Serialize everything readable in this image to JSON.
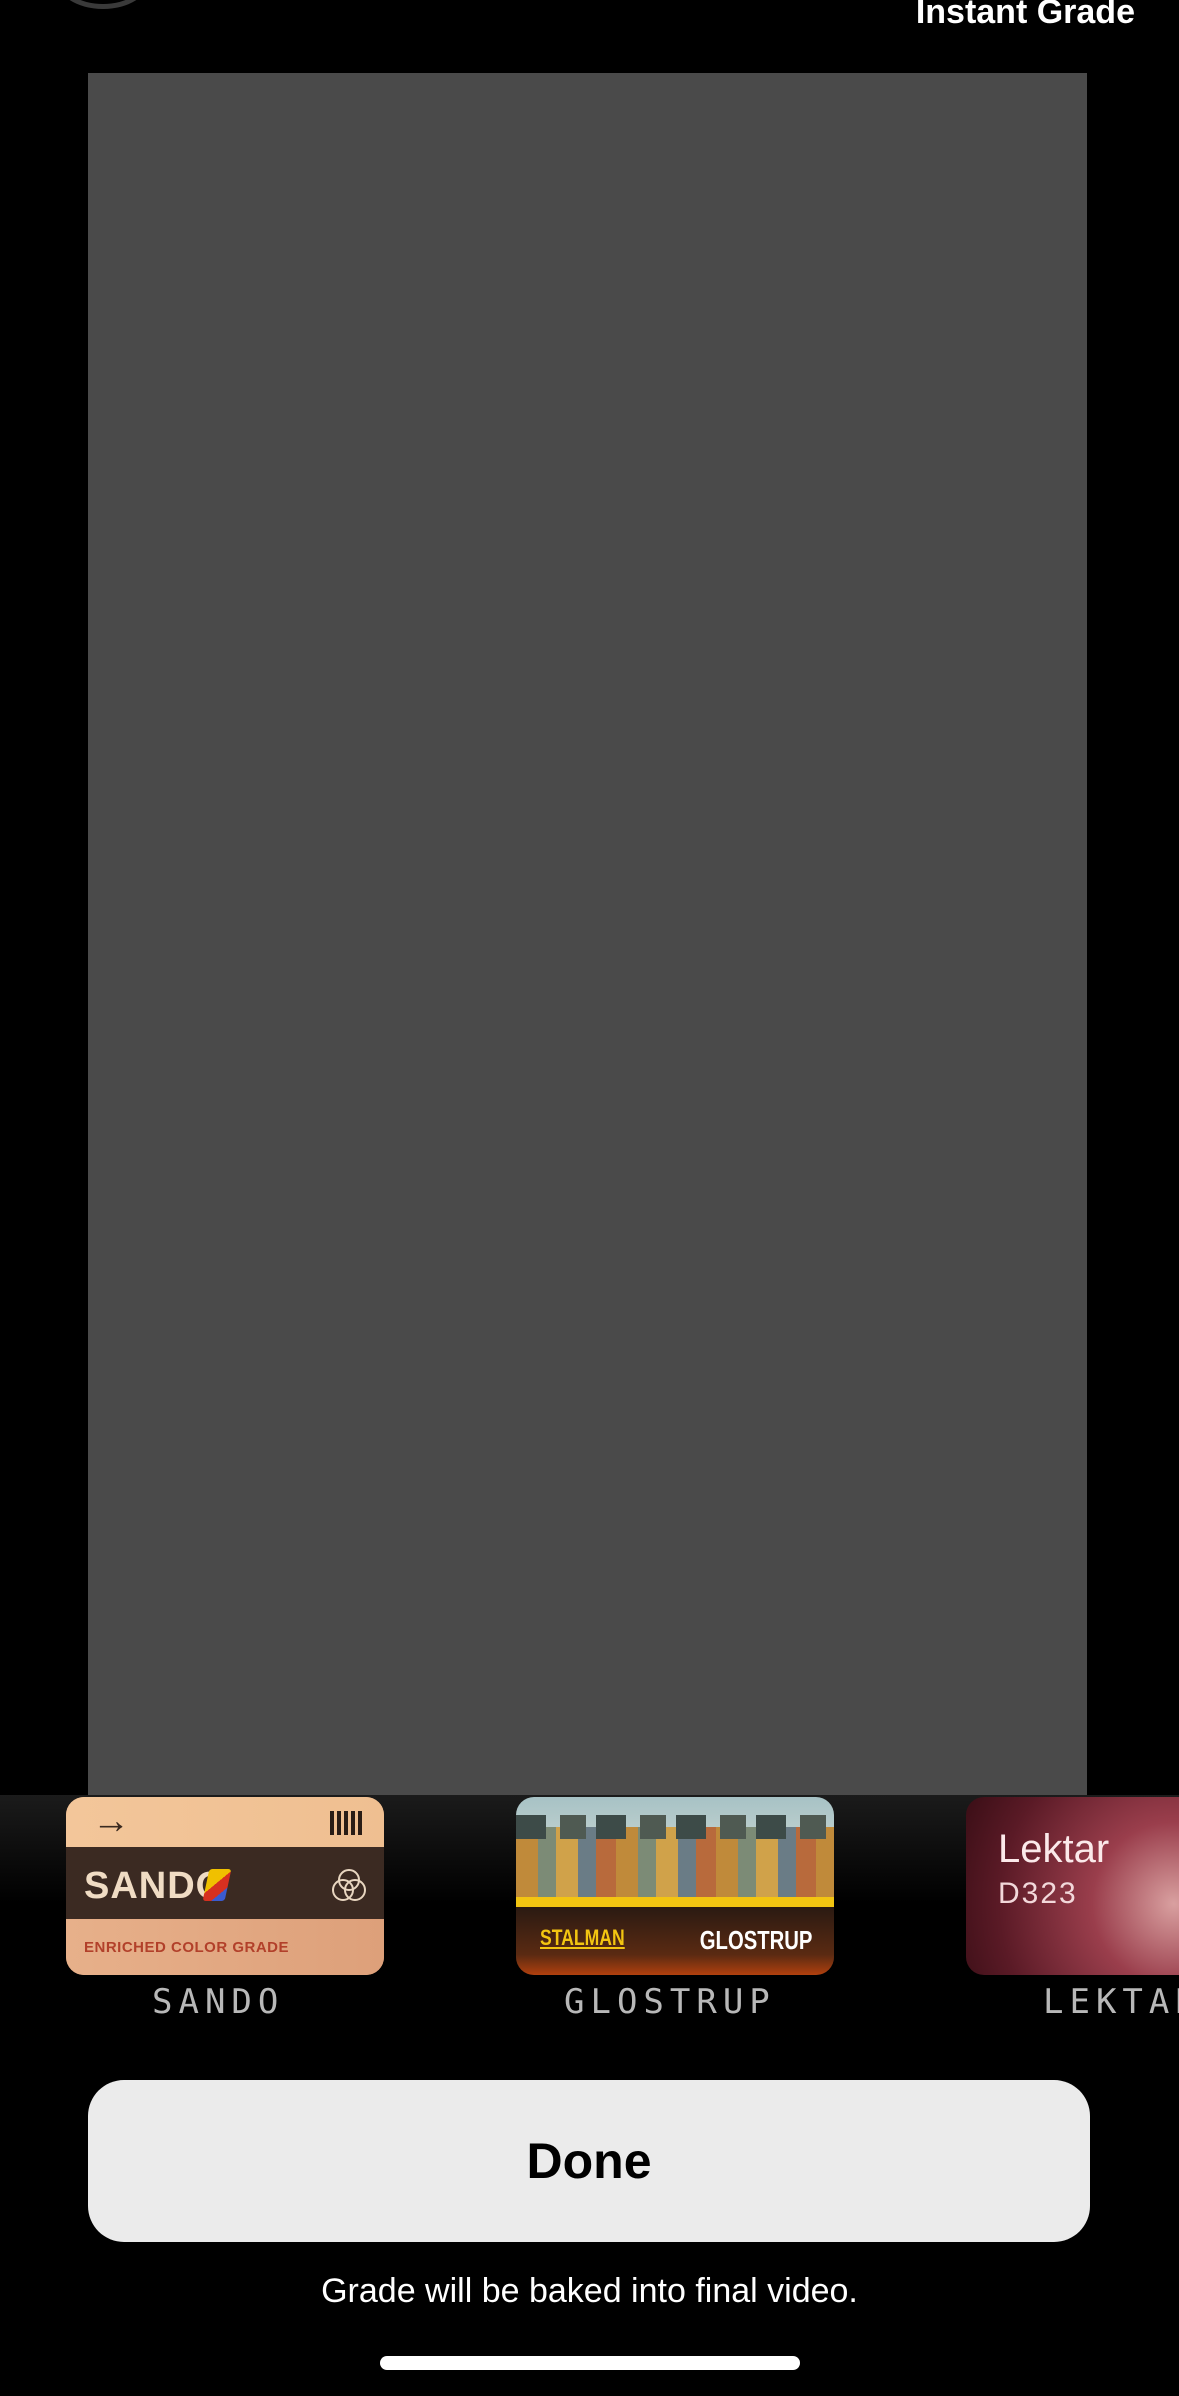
{
  "header": {
    "title": "Instant Grade"
  },
  "grades": [
    {
      "name": "SANDO",
      "card_title": "SANDO",
      "card_subtitle": "ENRICHED COLOR GRADE"
    },
    {
      "name": "GLOSTRUP",
      "card_left": "STALMAN",
      "card_right": "GLOSTRUP"
    },
    {
      "name": "LEKTAR",
      "card_title": "Lektar",
      "card_code": "D323"
    }
  ],
  "done_label": "Done",
  "hint": "Grade will be baked into final video."
}
